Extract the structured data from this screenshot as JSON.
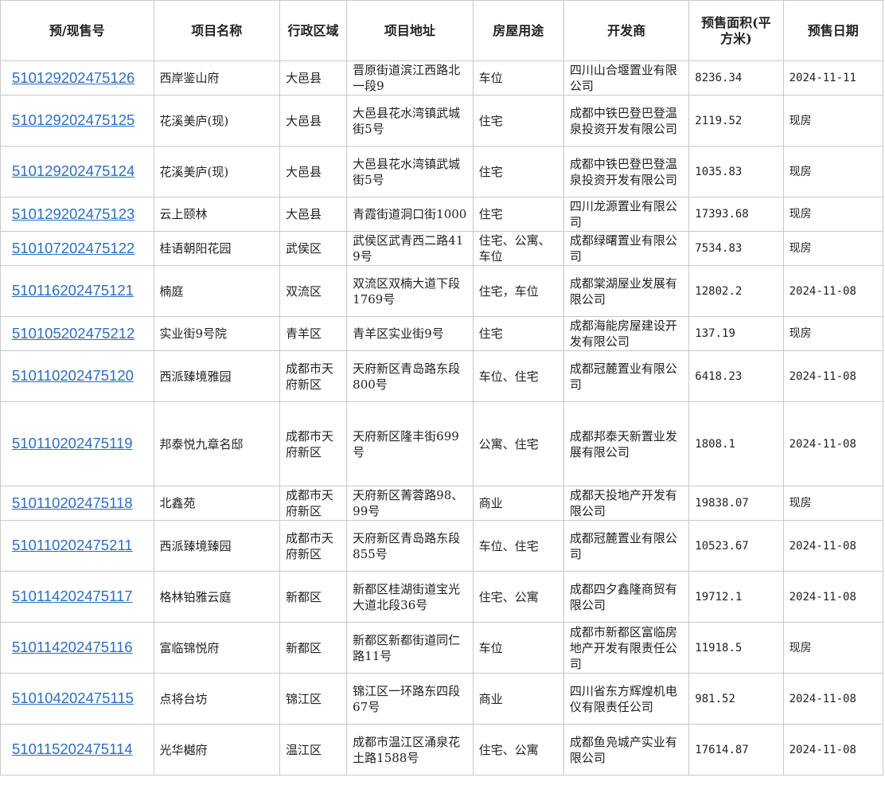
{
  "table": {
    "headers": [
      "预/现售号",
      "项目名称",
      "行政区域",
      "项目地址",
      "房屋用途",
      "开发商",
      "预售面积(平方米)",
      "预售日期"
    ],
    "rows": [
      {
        "id": "510129202475126",
        "name": "西岸鉴山府",
        "district": "大邑县",
        "address": "晋原街道滨江西路北一段9",
        "usage": "车位",
        "developer": "四川山合堰置业有限公司",
        "area": "8236.34",
        "date": "2024-11-11"
      },
      {
        "id": "510129202475125",
        "name": "花溪美庐(现)",
        "district": "大邑县",
        "address": "大邑县花水湾镇武城街5号",
        "usage": "住宅",
        "developer": "成都中铁巴登巴登温泉投资开发有限公司",
        "area": "2119.52",
        "date": "现房"
      },
      {
        "id": "510129202475124",
        "name": "花溪美庐(现)",
        "district": "大邑县",
        "address": "大邑县花水湾镇武城街5号",
        "usage": "住宅",
        "developer": "成都中铁巴登巴登温泉投资开发有限公司",
        "area": "1035.83",
        "date": "现房"
      },
      {
        "id": "510129202475123",
        "name": "云上颐林",
        "district": "大邑县",
        "address": "青霞街道洞口街1000",
        "usage": "住宅",
        "developer": "四川龙源置业有限公司",
        "area": "17393.68",
        "date": "现房"
      },
      {
        "id": "510107202475122",
        "name": "桂语朝阳花园",
        "district": "武侯区",
        "address": "武侯区武青西二路419号",
        "usage": "住宅、公寓、车位",
        "developer": "成都绿曙置业有限公司",
        "area": "7534.83",
        "date": "现房"
      },
      {
        "id": "510116202475121",
        "name": "楠庭",
        "district": "双流区",
        "address": "双流区双楠大道下段1769号",
        "usage": "住宅，车位",
        "developer": "成都棠湖屋业发展有限公司",
        "area": "12802.2",
        "date": "2024-11-08"
      },
      {
        "id": "510105202475212",
        "name": "实业街9号院",
        "district": "青羊区",
        "address": "青羊区实业街9号",
        "usage": "住宅",
        "developer": "成都海能房屋建设开发有限公司",
        "area": "137.19",
        "date": "现房"
      },
      {
        "id": "510110202475120",
        "name": "西派臻境雅园",
        "district": "成都市天府新区",
        "address": "天府新区青岛路东段800号",
        "usage": "车位、住宅",
        "developer": "成都冠麓置业有限公司",
        "area": "6418.23",
        "date": "2024-11-08"
      },
      {
        "id": "510110202475119",
        "name": "邦泰悦九章名邸",
        "district": "成都市天府新区",
        "address": "天府新区隆丰街699号",
        "usage": "公寓、住宅",
        "developer": "成都邦泰天新置业发展有限公司",
        "area": "1808.1",
        "date": "2024-11-08"
      },
      {
        "id": "510110202475118",
        "name": "北鑫苑",
        "district": "成都市天府新区",
        "address": "天府新区菁蓉路98、99号",
        "usage": "商业",
        "developer": "成都天投地产开发有限公司",
        "area": "19838.07",
        "date": "现房"
      },
      {
        "id": "510110202475211",
        "name": "西派臻境臻园",
        "district": "成都市天府新区",
        "address": "天府新区青岛路东段855号",
        "usage": "车位、住宅",
        "developer": "成都冠麓置业有限公司",
        "area": "10523.67",
        "date": "2024-11-08"
      },
      {
        "id": "510114202475117",
        "name": "格林铂雅云庭",
        "district": "新都区",
        "address": "新都区桂湖街道宝光大道北段36号",
        "usage": "住宅、公寓",
        "developer": "成都四夕鑫隆商贸有限公司",
        "area": "19712.1",
        "date": "2024-11-08"
      },
      {
        "id": "510114202475116",
        "name": "富临锦悦府",
        "district": "新都区",
        "address": "新都区新都街道同仁路11号",
        "usage": "车位",
        "developer": "成都市新都区富临房地产开发有限责任公司",
        "area": "11918.5",
        "date": "现房"
      },
      {
        "id": "510104202475115",
        "name": "点将台坊",
        "district": "锦江区",
        "address": "锦江区一环路东四段67号",
        "usage": "商业",
        "developer": "四川省东方辉煌机电仪有限责任公司",
        "area": "981.52",
        "date": "2024-11-08"
      },
      {
        "id": "510115202475114",
        "name": "光华樾府",
        "district": "温江区",
        "address": "成都市温江区涌泉花土路1588号",
        "usage": "住宅、公寓",
        "developer": "成都鱼凫城产实业有限公司",
        "area": "17614.87",
        "date": "2024-11-08"
      }
    ]
  }
}
